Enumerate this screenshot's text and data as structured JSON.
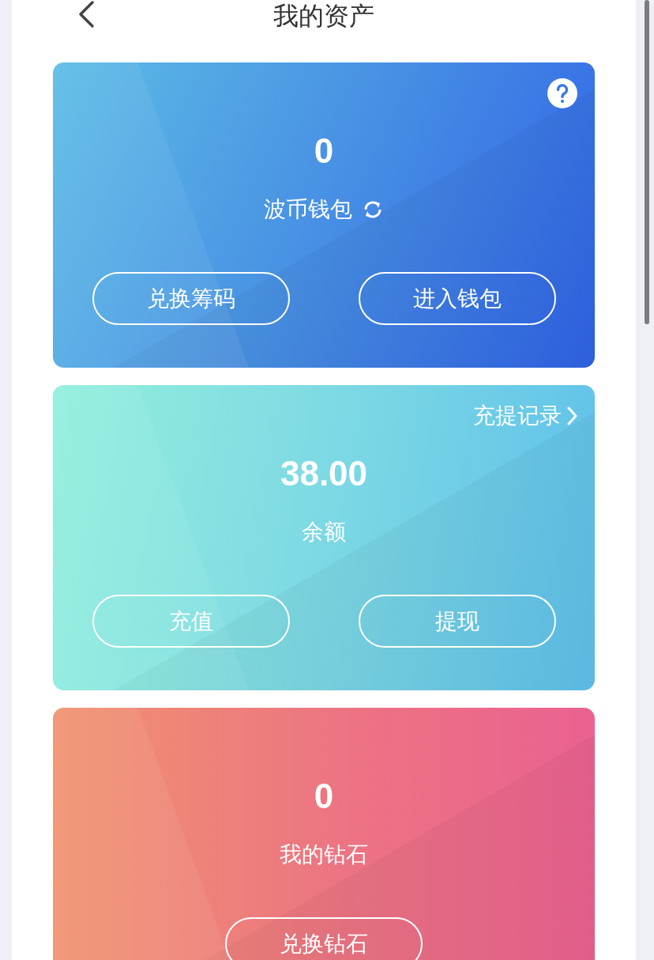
{
  "header": {
    "title": "我的资产"
  },
  "cards": [
    {
      "kind": "wallet",
      "amount": "0",
      "label": "波币钱包",
      "buttons": [
        "兑换筹码",
        "进入钱包"
      ]
    },
    {
      "kind": "balance",
      "link": "充提记录",
      "amount": "38.00",
      "label": "余额",
      "buttons": [
        "充值",
        "提现"
      ]
    },
    {
      "kind": "diamond",
      "amount": "0",
      "label": "我的钻石",
      "buttons": [
        "兑换钻石"
      ]
    }
  ]
}
